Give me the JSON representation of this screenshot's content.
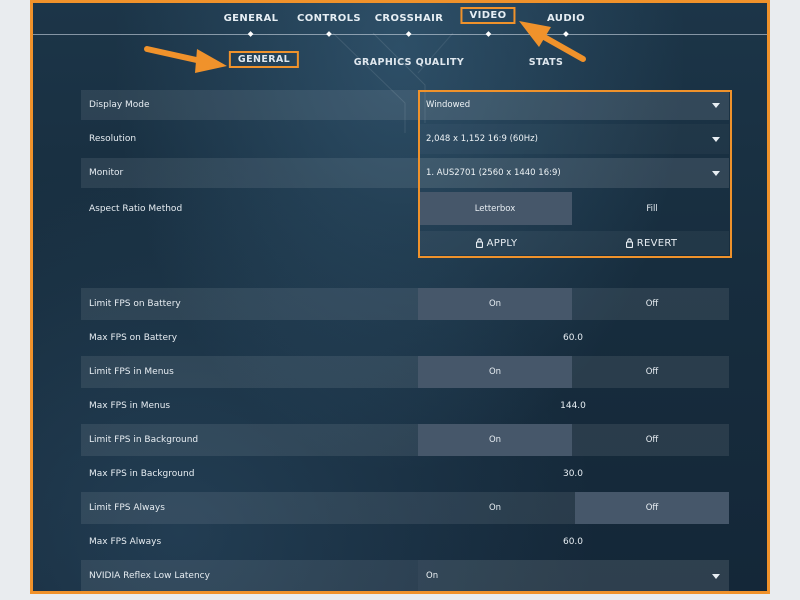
{
  "top_tabs": [
    "GENERAL",
    "CONTROLS",
    "CROSSHAIR",
    "VIDEO",
    "AUDIO"
  ],
  "sub_tabs": [
    "GENERAL",
    "GRAPHICS QUALITY",
    "STATS"
  ],
  "settings": {
    "display_mode": {
      "label": "Display Mode",
      "value": "Windowed"
    },
    "resolution": {
      "label": "Resolution",
      "value": "2,048 x 1,152 16:9 (60Hz)"
    },
    "monitor": {
      "label": "Monitor",
      "value": "1. AUS2701 (2560 x  1440 16:9)"
    },
    "aspect_ratio": {
      "label": "Aspect Ratio Method",
      "option_a": "Letterbox",
      "option_b": "Fill",
      "selected": "Letterbox"
    },
    "apply_label": "APPLY",
    "revert_label": "REVERT",
    "limit_fps_battery": {
      "label": "Limit FPS on Battery",
      "on": "On",
      "off": "Off",
      "selected": "On"
    },
    "max_fps_battery": {
      "label": "Max FPS on Battery",
      "value": "60.0"
    },
    "limit_fps_menus": {
      "label": "Limit FPS in Menus",
      "on": "On",
      "off": "Off",
      "selected": "On"
    },
    "max_fps_menus": {
      "label": "Max FPS in Menus",
      "value": "144.0"
    },
    "limit_fps_background": {
      "label": "Limit FPS in Background",
      "on": "On",
      "off": "Off",
      "selected": "On"
    },
    "max_fps_background": {
      "label": "Max FPS in Background",
      "value": "30.0"
    },
    "limit_fps_always": {
      "label": "Limit FPS Always",
      "on": "On",
      "off": "Off",
      "selected": "Off"
    },
    "max_fps_always": {
      "label": "Max FPS Always",
      "value": "60.0"
    },
    "nvidia_reflex": {
      "label": "NVIDIA Reflex Low Latency",
      "value": "On"
    }
  },
  "colors": {
    "highlight": "#f0922b",
    "background": "#172d3e",
    "selected_segment": "#46576a"
  },
  "icons": [
    "lock-icon",
    "caret-down-icon",
    "arrow-pointer-icon"
  ]
}
